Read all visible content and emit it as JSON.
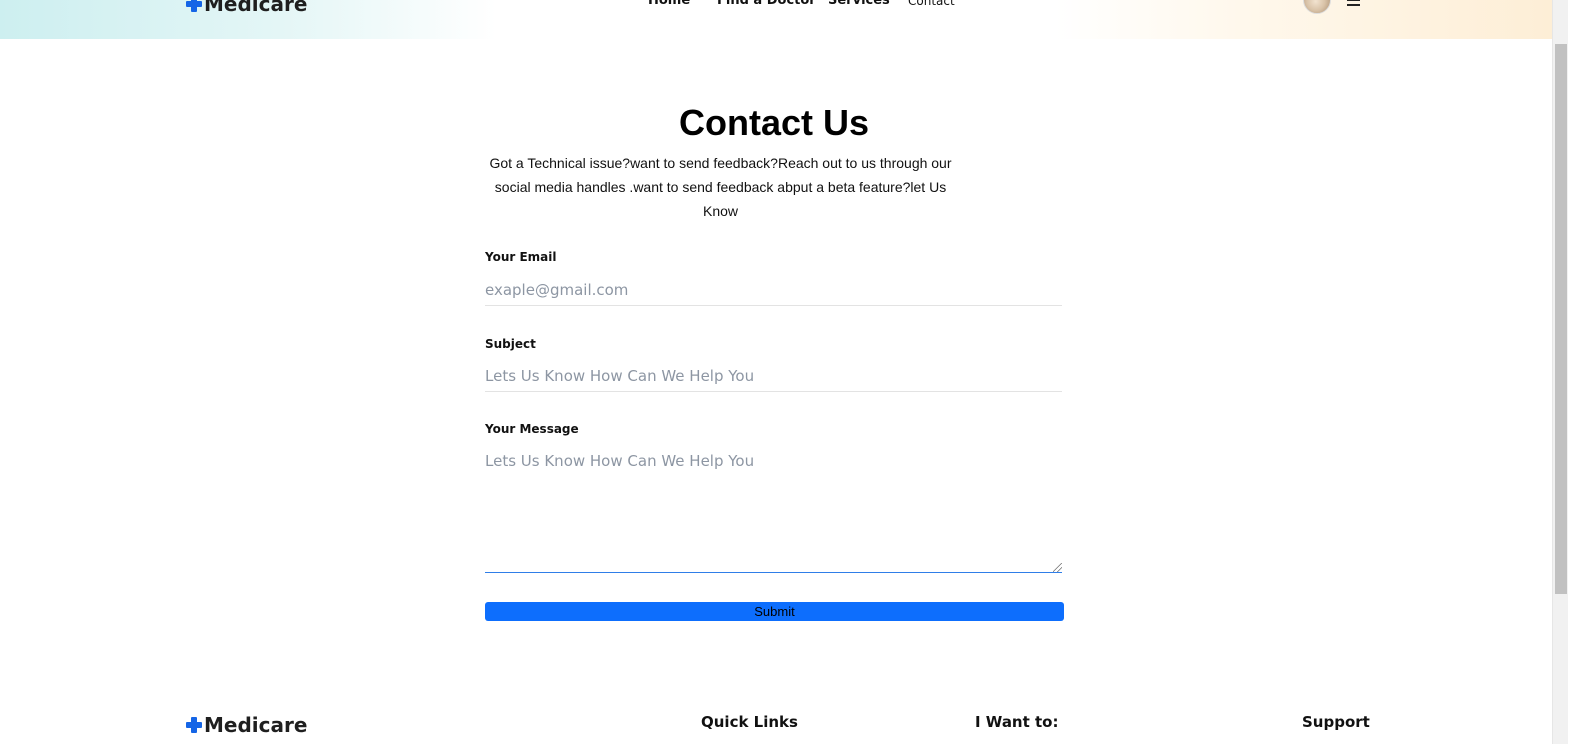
{
  "header": {
    "brand": "Medicare",
    "nav": [
      "Home",
      "Find a Doctor",
      "Services",
      "Contact"
    ]
  },
  "contact": {
    "title": "Contact Us",
    "intro": "Got a Technical issue?want to send feedback?Reach out to us through our social media handles .want to send feedback abput a beta feature?let Us Know",
    "email_label": "Your Email",
    "email_placeholder": "exaple@gmail.com",
    "subject_label": "Subject",
    "subject_placeholder": "Lets Us Know How Can We Help You",
    "message_label": "Your Message",
    "message_placeholder": "Lets Us Know How Can We Help You",
    "submit_label": "Submit"
  },
  "footer": {
    "brand": "Medicare",
    "headings": [
      "Quick Links",
      "I Want to:",
      "Support"
    ]
  },
  "colors": {
    "accent": "#0d6efd",
    "brand_plus": "#1565e6",
    "focus_border": "#2f7ee8"
  },
  "icons": [
    "plus-logo-icon",
    "avatar",
    "hamburger-menu-icon",
    "resize-grip-icon"
  ]
}
